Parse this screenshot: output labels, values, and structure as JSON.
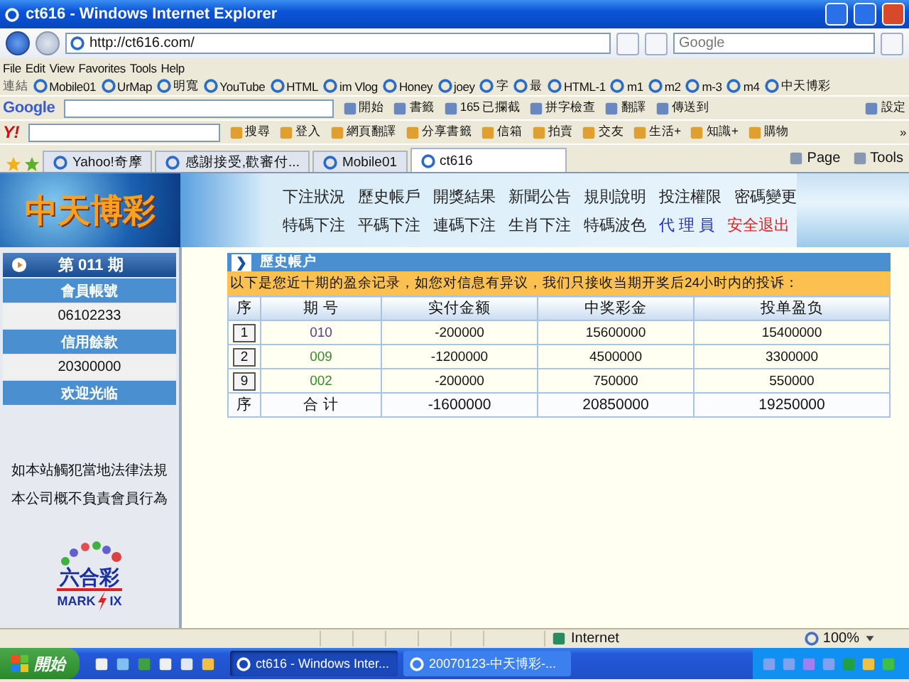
{
  "window": {
    "title": "ct616 - Windows Internet Explorer"
  },
  "address_bar": {
    "url": "http://ct616.com/",
    "search_placeholder": "Google"
  },
  "menu": [
    "File",
    "Edit",
    "View",
    "Favorites",
    "Tools",
    "Help"
  ],
  "links_bar": {
    "label": "連結",
    "items": [
      "Mobile01",
      "UrMap",
      "明寬",
      "YouTube",
      "HTML",
      "im Vlog",
      "Honey",
      "joey",
      "字",
      "最",
      "HTML-1",
      "m1",
      "m2",
      "m-3",
      "m4",
      "中天博彩"
    ]
  },
  "google_toolbar": {
    "logo": "Google",
    "items": [
      "開始",
      "書籤",
      "165 已攔截",
      "拼字檢查",
      "翻譯",
      "傳送到",
      "設定"
    ]
  },
  "yahoo_toolbar": {
    "logo": "Y!",
    "items": [
      "搜尋",
      "登入",
      "網頁翻譯",
      "分享書籤",
      "信箱",
      "拍賣",
      "交友",
      "生活+",
      "知識+",
      "購物"
    ],
    "more": "»"
  },
  "tabs": [
    {
      "label": "Yahoo!奇摩",
      "selected": false
    },
    {
      "label": "感謝接受,歡審付...",
      "selected": false
    },
    {
      "label": "Mobile01",
      "selected": false
    },
    {
      "label": "ct616",
      "selected": true
    }
  ],
  "tab_tools": [
    "Page",
    "Tools"
  ],
  "site": {
    "logo": "中天博彩",
    "nav_rows": [
      [
        {
          "label": "下注狀況",
          "color": "#222222"
        },
        {
          "label": "歷史帳戶",
          "color": "#222222"
        },
        {
          "label": "開獎結果",
          "color": "#222222"
        },
        {
          "label": "新聞公告",
          "color": "#222222"
        },
        {
          "label": "規則說明",
          "color": "#222222"
        },
        {
          "label": "投注權限",
          "color": "#222222"
        },
        {
          "label": "密碼變更",
          "color": "#222222"
        }
      ],
      [
        {
          "label": "特碼下注",
          "color": "#222222"
        },
        {
          "label": "平碼下注",
          "color": "#222222"
        },
        {
          "label": "連碼下注",
          "color": "#222222"
        },
        {
          "label": "生肖下注",
          "color": "#222222"
        },
        {
          "label": "特碼波色",
          "color": "#222222"
        },
        {
          "label": "代 理 員",
          "color": "#2030c0"
        },
        {
          "label": "安全退出",
          "color": "#e02020"
        }
      ]
    ]
  },
  "sidebar": {
    "period": "第 011 期",
    "sections": [
      {
        "heading": "會員帳號",
        "value": "06102233"
      },
      {
        "heading": "信用餘款",
        "value": "20300000"
      },
      {
        "heading": "欢迎光临"
      }
    ],
    "notices": [
      "如本站觸犯當地法律法規",
      "本公司概不負責會員行為"
    ],
    "logo": {
      "cn": "六合彩",
      "en_left": "MARK",
      "en_right": "IX"
    }
  },
  "panel": {
    "chevron": "❯",
    "title": "歷史帳户",
    "notice": "以下是您近十期的盈余记录，如您对信息有异议，我们只接收当期开奖后24小时内的投诉：",
    "columns": [
      "序",
      "期 号",
      "实付金额",
      "中奖彩金",
      "投单盈负"
    ],
    "rows": [
      {
        "index": "1",
        "period": "010",
        "color": "#5a3c90",
        "paid": "-200000",
        "prize": "15600000",
        "profit": "15400000"
      },
      {
        "index": "2",
        "period": "009",
        "color": "#3a8a2a",
        "paid": "-1200000",
        "prize": "4500000",
        "profit": "3300000"
      },
      {
        "index": "9",
        "period": "002",
        "color": "#3a8a2a",
        "paid": "-200000",
        "prize": "750000",
        "profit": "550000"
      }
    ],
    "total": [
      "序",
      "合 计",
      "-1600000",
      "20850000",
      "19250000"
    ]
  },
  "status_bar": {
    "zone": "Internet",
    "zoom": "100%"
  },
  "taskbar": {
    "start": "開始",
    "windows": [
      {
        "label": "ct616 - Windows Inter...",
        "selected": true
      },
      {
        "label": "20070123-中天博彩-...",
        "selected": false
      }
    ]
  }
}
